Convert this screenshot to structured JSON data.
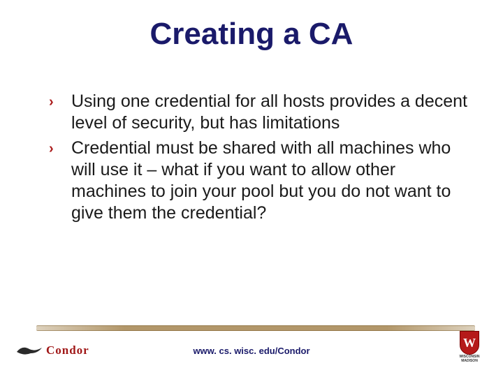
{
  "title": "Creating a CA",
  "bullets": [
    "Using one credential for all hosts provides a decent level of security, but has limitations",
    "Credential must be shared with all machines who will use it – what if you want to allow other machines to join your pool but you do not want to give them the credential?"
  ],
  "footer": {
    "url": "www. cs. wisc. edu/Condor",
    "left_logo": {
      "name": "condor-logo",
      "text": "Condor"
    },
    "right_logo": {
      "name": "uw-logo",
      "letter": "W",
      "line1": "WISCONSIN",
      "line2": "MADISON"
    }
  },
  "colors": {
    "title": "#1a1a6a",
    "bullet_marker": "#aa1a1a",
    "rule": "#aa8c5a",
    "condor_red": "#a01818",
    "uw_red": "#b51a1a"
  }
}
